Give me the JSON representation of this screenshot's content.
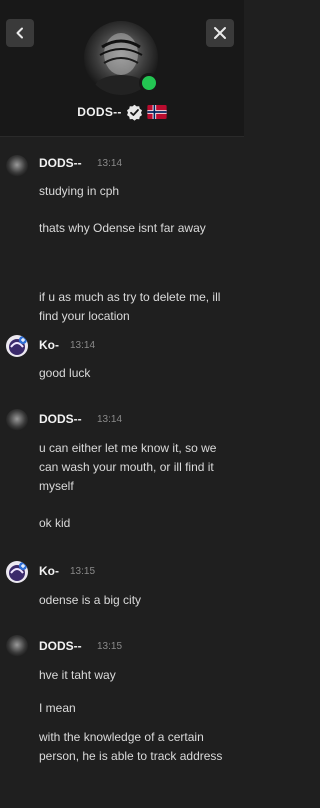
{
  "profile": {
    "name": "DODS--",
    "status_color": "#23c552",
    "flag_colors": {
      "red": "#ba0c2f",
      "white": "#ffffff",
      "blue": "#00205b"
    }
  },
  "icons": {
    "back": "chevron-left-icon",
    "close": "close-icon",
    "verified": "verified-badge-icon",
    "flag": "norway-flag-icon"
  },
  "messages": [
    {
      "author": "DODS--",
      "time": "13:14",
      "lines": [
        "studying in cph",
        "thats why Odense isnt far away",
        "if u as much as try to delete me, ill find your location"
      ]
    },
    {
      "author": "Ko-",
      "time": "13:14",
      "lines": [
        "good luck"
      ]
    },
    {
      "author": "DODS--",
      "time": "13:14",
      "lines": [
        "u can either let me know it, so we can wash your mouth, or ill find it myself",
        "ok kid"
      ]
    },
    {
      "author": "Ko-",
      "time": "13:15",
      "lines": [
        "odense is a big city"
      ]
    },
    {
      "author": "DODS--",
      "time": "13:15",
      "lines": [
        "hve it taht way",
        "I mean",
        "with the knowledge of a certain person, he is able to track address"
      ]
    }
  ]
}
